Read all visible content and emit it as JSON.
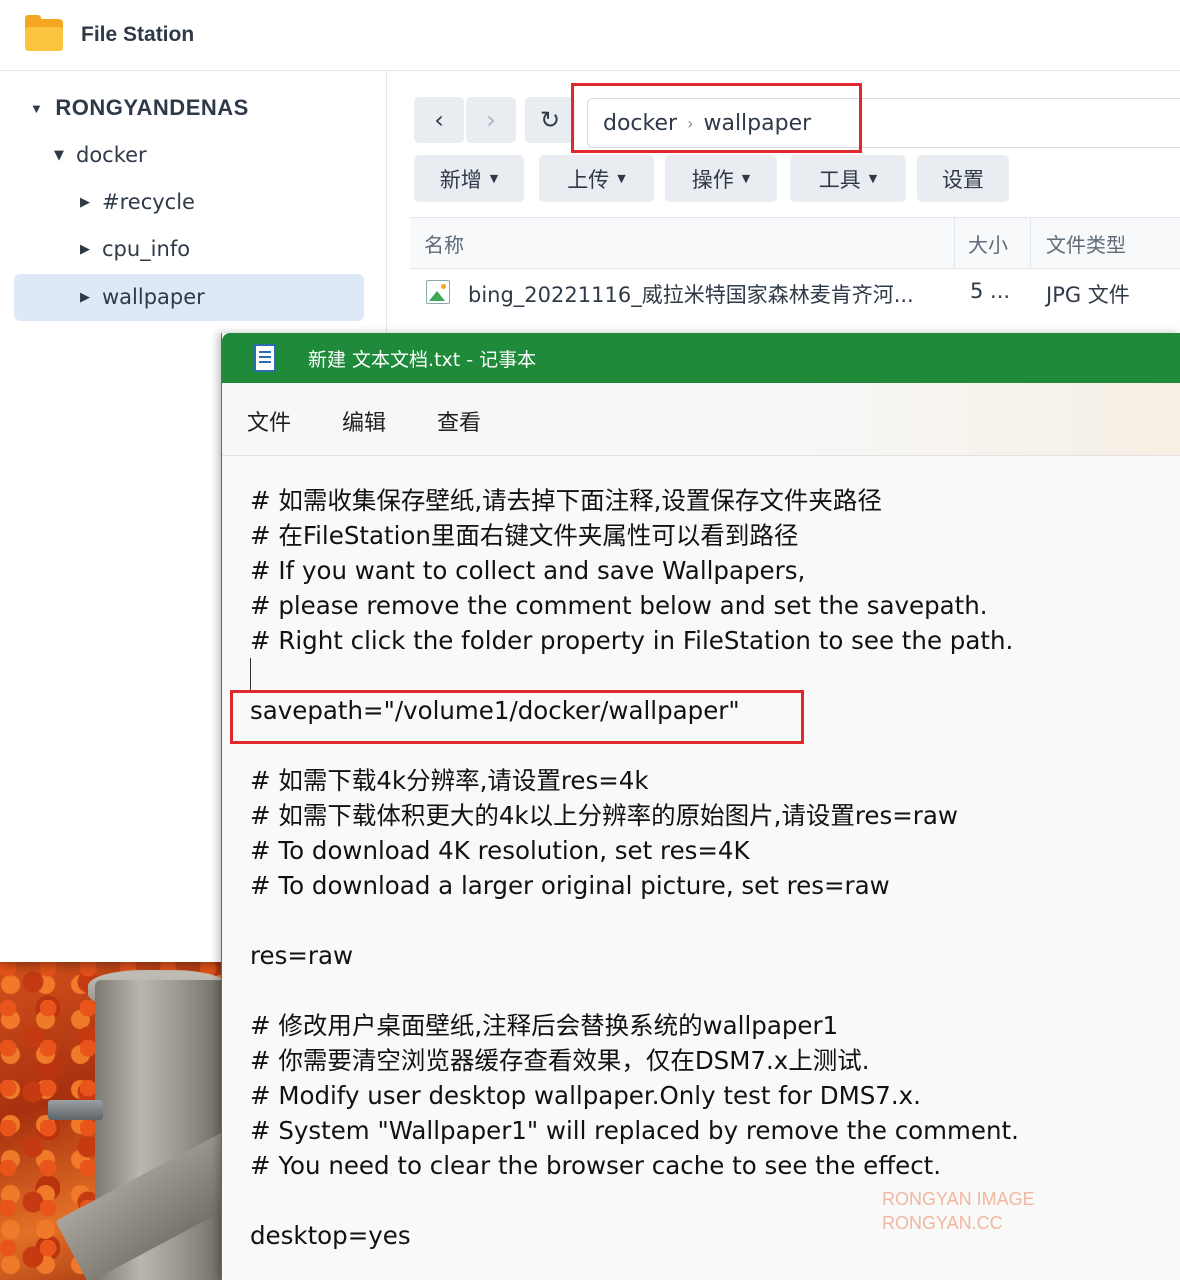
{
  "file_station": {
    "app_title": "File Station",
    "tree": {
      "root": "RONGYANDENAS",
      "docker": "docker",
      "children": [
        "#recycle",
        "cpu_info",
        "wallpaper"
      ]
    },
    "path": [
      "docker",
      "wallpaper"
    ],
    "actions": [
      "新增",
      "上传",
      "操作",
      "工具",
      "设置"
    ],
    "columns": [
      "名称",
      "大小",
      "文件类型"
    ],
    "files": [
      {
        "name": "bing_20221116_威拉米特国家森林麦肯齐河...",
        "size": "5 ...",
        "type": "JPG 文件"
      }
    ]
  },
  "notepad": {
    "title": "新建 文本文档.txt - 记事本",
    "menu": [
      "文件",
      "编辑",
      "查看"
    ],
    "lines": [
      "# 如需收集保存壁纸,请去掉下面注释,设置保存文件夹路径",
      "# 在FileStation里面右键文件夹属性可以看到路径",
      "# If you want to collect and save Wallpapers,",
      "# please remove the comment below and set the savepath.",
      "# Right click the folder property in FileStation to see the path.",
      "",
      "savepath=\"/volume1/docker/wallpaper\"",
      "",
      "# 如需下载4k分辨率,请设置res=4k",
      "# 如需下载体积更大的4k以上分辨率的原始图片,请设置res=raw",
      "# To download 4K resolution, set res=4K",
      "# To download a larger original picture, set res=raw",
      "",
      "res=raw",
      "",
      "# 修改用户桌面壁纸,注释后会替换系统的wallpaper1",
      "# 你需要清空浏览器缓存查看效果，仅在DSM7.x上测试.",
      "# Modify user desktop wallpaper.Only test for DMS7.x.",
      "# System \"Wallpaper1\" will replaced by remove the comment.",
      "# You need to clear the browser cache to see the effect.",
      "",
      "desktop=yes"
    ]
  },
  "watermark": [
    "RONGYAN IMAGE",
    "RONGYAN.CC"
  ],
  "colors": {
    "highlight": "#e0282e",
    "notepad_title": "#1f8b3a",
    "selection": "#dde9f7"
  }
}
